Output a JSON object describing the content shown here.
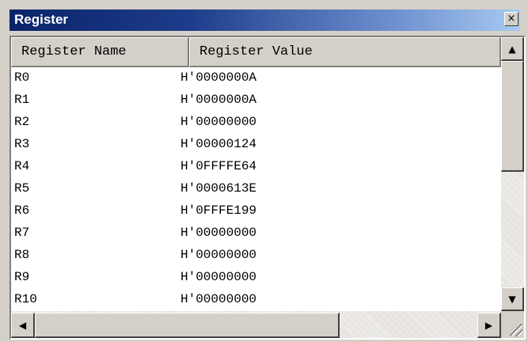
{
  "window": {
    "title": "Register",
    "close_glyph": "×"
  },
  "columns": {
    "name": "Register Name",
    "value": "Register Value"
  },
  "registers": [
    {
      "name": "R0",
      "value": "H'0000000A"
    },
    {
      "name": "R1",
      "value": "H'0000000A"
    },
    {
      "name": "R2",
      "value": "H'00000000"
    },
    {
      "name": "R3",
      "value": "H'00000124"
    },
    {
      "name": "R4",
      "value": "H'0FFFFE64"
    },
    {
      "name": "R5",
      "value": "H'0000613E"
    },
    {
      "name": "R6",
      "value": "H'0FFFE199"
    },
    {
      "name": "R7",
      "value": "H'00000000"
    },
    {
      "name": "R8",
      "value": "H'00000000"
    },
    {
      "name": "R9",
      "value": "H'00000000"
    },
    {
      "name": "R10",
      "value": "H'00000000"
    }
  ],
  "scrollbar": {
    "up": "▲",
    "down": "▼",
    "left": "◀",
    "right": "▶"
  }
}
